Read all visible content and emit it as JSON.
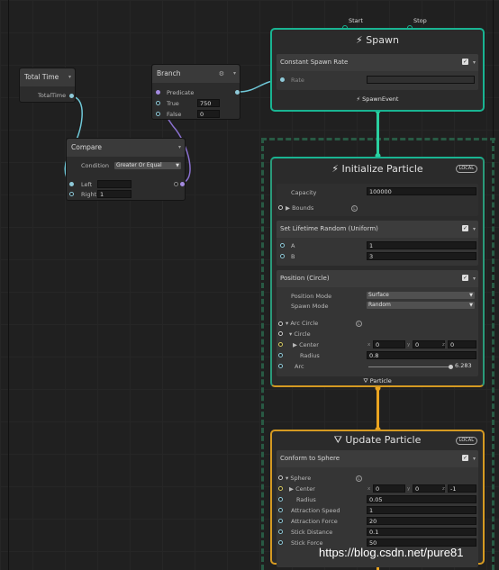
{
  "nodes": {
    "total_time": {
      "title": "Total Time",
      "output": "TotalTime"
    },
    "branch": {
      "title": "Branch",
      "predicate": "Predicate",
      "true_label": "True",
      "true_value": "750",
      "false_label": "False",
      "false_value": "0"
    },
    "compare": {
      "title": "Compare",
      "condition_label": "Condition",
      "condition_value": "Greater Or Equal",
      "left_label": "Left",
      "left_value": "",
      "right_label": "Right",
      "right_value": "1"
    }
  },
  "spawn": {
    "title": "Spawn",
    "start": "Start",
    "stop": "Stop",
    "block_title": "Constant Spawn Rate",
    "rate_label": "Rate",
    "rate_value": "",
    "event": "SpawnEvent"
  },
  "init": {
    "title": "Initialize Particle",
    "badge": "LOCAL",
    "capacity_label": "Capacity",
    "capacity_value": "100000",
    "bounds_label": "Bounds",
    "lifetime": {
      "title": "Set Lifetime Random (Uniform)",
      "a_label": "A",
      "a_value": "1",
      "b_label": "B",
      "b_value": "3"
    },
    "position": {
      "title": "Position (Circle)",
      "mode_label": "Position Mode",
      "mode_value": "Surface",
      "spawn_mode_label": "Spawn Mode",
      "spawn_mode_value": "Random",
      "arc_circle_label": "Arc Circle",
      "circle_label": "Circle",
      "center_label": "Center",
      "x_label": "x",
      "x_value": "0",
      "y_label": "y",
      "y_value": "0",
      "z_label": "z",
      "z_value": "0",
      "radius_label": "Radius",
      "radius_value": "0.8",
      "arc_label": "Arc",
      "arc_value": "6.283",
      "arc_fraction": 1.0
    },
    "footer": "Particle"
  },
  "update": {
    "title": "Update Particle",
    "badge": "LOCAL",
    "block_title": "Conform to Sphere",
    "sphere_label": "Sphere",
    "center_label": "Center",
    "x_label": "x",
    "x_value": "0",
    "y_label": "y",
    "y_value": "0",
    "z_label": "z",
    "z_value": "-1",
    "radius_label": "Radius",
    "radius_value": "0.05",
    "speed_label": "Attraction Speed",
    "speed_value": "1",
    "force_label": "Attraction Force",
    "force_value": "20",
    "stick_dist_label": "Stick Distance",
    "stick_dist_value": "0.1",
    "stick_force_label": "Stick Force",
    "stick_force_value": "50"
  },
  "watermark": "https://blog.csdn.net/pure81"
}
